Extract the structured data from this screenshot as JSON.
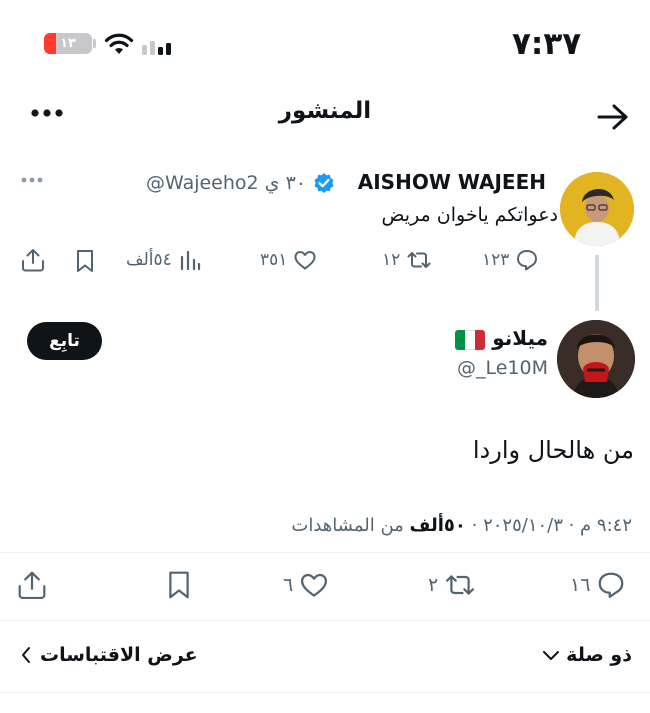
{
  "status_bar": {
    "time": "٧:٣٧",
    "battery_level": "١٣"
  },
  "header": {
    "title": "المنشور"
  },
  "parent_post": {
    "display_name": "AISHOW WAJEEH",
    "handle_time": "@Wajeeho2 ٣٠ ي",
    "text": "دعواتكم ياخوان مريض",
    "replies": "١٢٣",
    "reposts": "١٢",
    "likes": "٣٥١",
    "views": "٥٤ألف"
  },
  "main_post": {
    "display_name": "ميلانو",
    "handle": "@_Le10M",
    "follow_label": "تابِع",
    "text": "من هالحال واردا",
    "timestamp": "٩:٤٢ م · ٢٠٢٥/١٠/٣ ·",
    "views_count": "٥٠ألف",
    "views_label": "من المشاهدات",
    "replies": "١٦",
    "reposts": "٢",
    "likes": "٦"
  },
  "footer": {
    "relevance_label": "ذو صلة",
    "quotes_label": "عرض الاقتباسات"
  },
  "colors": {
    "text": "#0f1419",
    "secondary": "#536471",
    "verified": "#1d9bf0",
    "flag_green": "#009246",
    "flag_white": "#ffffff",
    "flag_red": "#ce2b37"
  }
}
